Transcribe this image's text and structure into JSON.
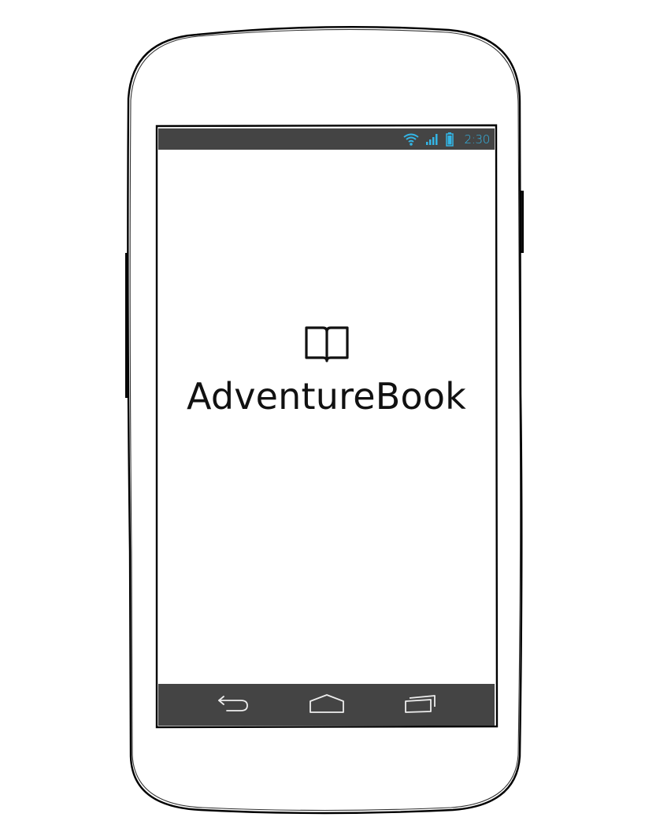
{
  "status_bar": {
    "time": "2:30",
    "icons": [
      "wifi-icon",
      "signal-icon",
      "battery-icon"
    ],
    "accent_color": "#33b5e5",
    "background_color": "#444444"
  },
  "splash": {
    "icon": "book-icon",
    "title": "AdventureBook"
  },
  "nav_bar": {
    "buttons": [
      "back-icon",
      "home-icon",
      "recent-apps-icon"
    ],
    "background_color": "#444444"
  }
}
